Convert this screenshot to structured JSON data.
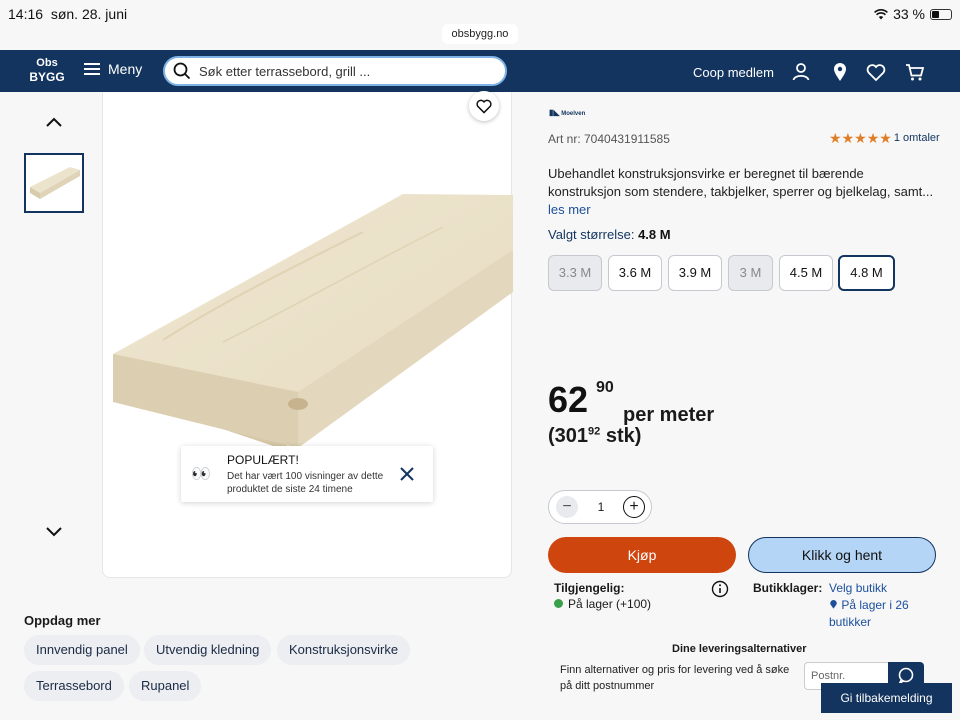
{
  "status_bar": {
    "time": "14:16",
    "date": "søn. 28. juni",
    "battery": "33 %",
    "url": "obsbygg.no"
  },
  "header": {
    "logo_line1": "Obs",
    "logo_line2": "BYGG",
    "menu_label": "Meny",
    "search_placeholder": "Søk etter terrassebord, grill ...",
    "coop_label": "Coop medlem"
  },
  "popup": {
    "title": "POPULÆRT!",
    "text": "Det har vært 100 visninger av dette produktet de siste 24 timene"
  },
  "discover": {
    "title": "Oppdag mer",
    "chips": [
      "Innvendig panel",
      "Utvendig kledning",
      "Konstruksjonsvirke",
      "Terrassebord",
      "Rupanel"
    ]
  },
  "product": {
    "brand": "Moelven",
    "art_nr": "Art nr: 7040431911585",
    "rating_count": "1 omtaler",
    "description": "Ubehandlet konstruksjonsvirke er beregnet til bærende konstruksjon som stendere, takbjelker, sperrer og bjelkelag, samt...",
    "read_more": "les mer",
    "size_label": "Valgt størrelse:",
    "selected_size": "4.8 M",
    "sizes": [
      "3.3 M",
      "3.6 M",
      "3.9 M",
      "3 M",
      "4.5 M",
      "4.8 M"
    ],
    "price_whole": "62",
    "price_decimal": "90",
    "price_unit": "per meter",
    "piece_price_open": "(301",
    "piece_price_decimal": "92",
    "piece_price_unit": "stk)",
    "quantity": "1",
    "buy_label": "Kjøp",
    "click_collect_label": "Klikk og hent",
    "availability_title": "Tilgjengelig:",
    "availability_text": "På lager (+100)",
    "store_title": "Butikklager:",
    "store_link": "Velg butikk",
    "store_stock": "På lager i 26 butikker",
    "delivery_title": "Dine leveringsalternativer",
    "delivery_text": "Finn alternativer og pris for levering ved å søke på ditt postnummer",
    "postnr_placeholder": "Postnr.",
    "feedback_label": "Gi tilbakemelding"
  }
}
